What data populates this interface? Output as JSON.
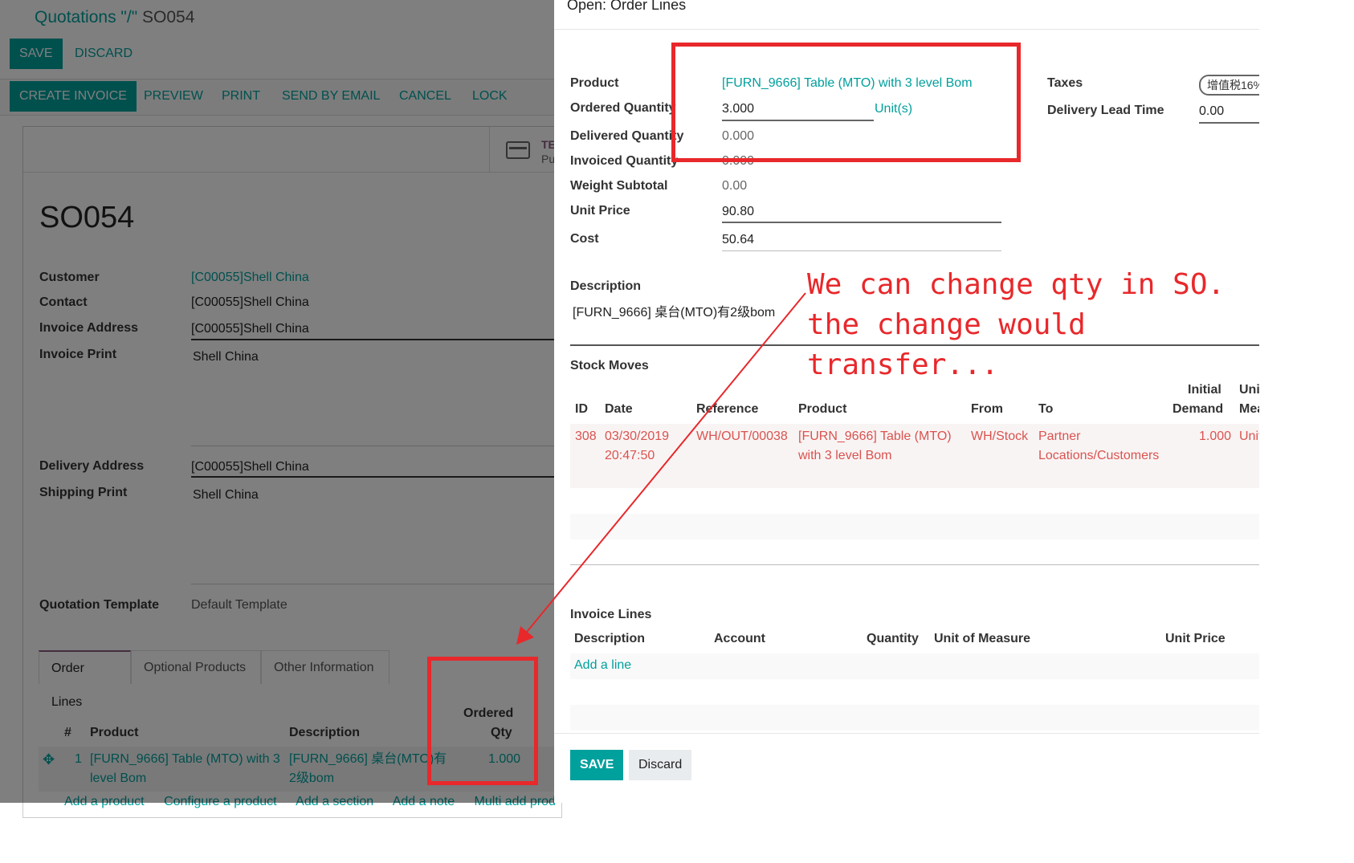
{
  "background": {
    "breadcrumb": {
      "link": "Quotations \"/\"",
      "current": "SO054"
    },
    "save_button": "SAVE",
    "discard_button": "DISCARD",
    "status_actions": [
      "CREATE INVOICE",
      "PREVIEW",
      "PRINT",
      "SEND BY EMAIL",
      "CANCEL",
      "LOCK"
    ],
    "smart_button": {
      "line1": "TE",
      "line2": "Pu",
      "icon": "credit-card-icon"
    },
    "so_name": "SO054",
    "fields": {
      "customer_label": "Customer",
      "customer_value": "[C00055]Shell China",
      "contact_label": "Contact",
      "contact_value": "[C00055]Shell China",
      "invoice_address_label": "Invoice Address",
      "invoice_address_value": "[C00055]Shell China",
      "invoice_print_label": "Invoice Print",
      "invoice_print_value": "Shell China",
      "delivery_address_label": "Delivery Address",
      "delivery_address_value": "[C00055]Shell China",
      "shipping_print_label": "Shipping Print",
      "shipping_print_value": "Shell China",
      "quotation_template_label": "Quotation Template",
      "quotation_template_value": "Default Template"
    },
    "tabs": [
      "Order Lines",
      "Optional Products",
      "Other Information"
    ],
    "order_lines": {
      "headers": {
        "num": "#",
        "product": "Product",
        "description": "Description",
        "qty_line1": "Ordered",
        "qty_line2": "Qty"
      },
      "row": {
        "num": "1",
        "product_l1": "[FURN_9666] Table (MTO) with 3",
        "product_l2": "level Bom",
        "desc_l1": "[FURN_9666] 桌台(MTO)有",
        "desc_l2": "2级bom",
        "qty": "1.000"
      },
      "add_links": [
        "Add a product",
        "Configure a product",
        "Add a section",
        "Add a note",
        "Multi add prod"
      ]
    }
  },
  "dialog": {
    "title": "Open: Order Lines",
    "product_label": "Product",
    "product_value": "[FURN_9666] Table (MTO) with 3 level Bom",
    "ordered_qty_label": "Ordered Quantity",
    "ordered_qty_value": "3.000",
    "uom_value": "Unit(s)",
    "delivered_qty_label": "Delivered Quantity",
    "delivered_qty_value": "0.000",
    "invoiced_qty_label": "Invoiced Quantity",
    "invoiced_qty_value": "0.000",
    "weight_label": "Weight Subtotal",
    "weight_value": "0.00",
    "unit_price_label": "Unit Price",
    "unit_price_value": "90.80",
    "cost_label": "Cost",
    "cost_value": "50.64",
    "taxes_label": "Taxes",
    "taxes_value": "增值税16%",
    "lead_time_label": "Delivery Lead Time",
    "lead_time_value": "0.00",
    "description_label": "Description",
    "description_value": "[FURN_9666] 桌台(MTO)有2级bom",
    "stock_moves": {
      "title": "Stock Moves",
      "headers": {
        "id": "ID",
        "date": "Date",
        "reference": "Reference",
        "product": "Product",
        "from": "From",
        "to": "To",
        "demand_l1": "Initial",
        "demand_l2": "Demand",
        "uom_l1": "Unit",
        "uom_l2": "Meas"
      },
      "row": {
        "id": "308",
        "date_l1": "03/30/2019",
        "date_l2": "20:47:50",
        "reference": "WH/OUT/00038",
        "product_l1": "[FURN_9666] Table (MTO)",
        "product_l2": "with 3 level Bom",
        "from": "WH/Stock",
        "to_l1": "Partner",
        "to_l2": "Locations/Customers",
        "demand": "1.000",
        "uom": "Unit"
      }
    },
    "invoice_lines": {
      "title": "Invoice Lines",
      "headers": {
        "description": "Description",
        "account": "Account",
        "quantity": "Quantity",
        "uom": "Unit of Measure",
        "unit_price": "Unit Price"
      },
      "add_line": "Add a line"
    },
    "save_button": "SAVE",
    "discard_button": "Discard"
  },
  "annotation": {
    "line1": "We can change qty in SO.",
    "line2": "the change would",
    "line3": "transfer...",
    "color": "#e8282b"
  },
  "colors": {
    "primary": "#00A09D",
    "accent": "#875A7B",
    "danger": "#d9534f"
  }
}
